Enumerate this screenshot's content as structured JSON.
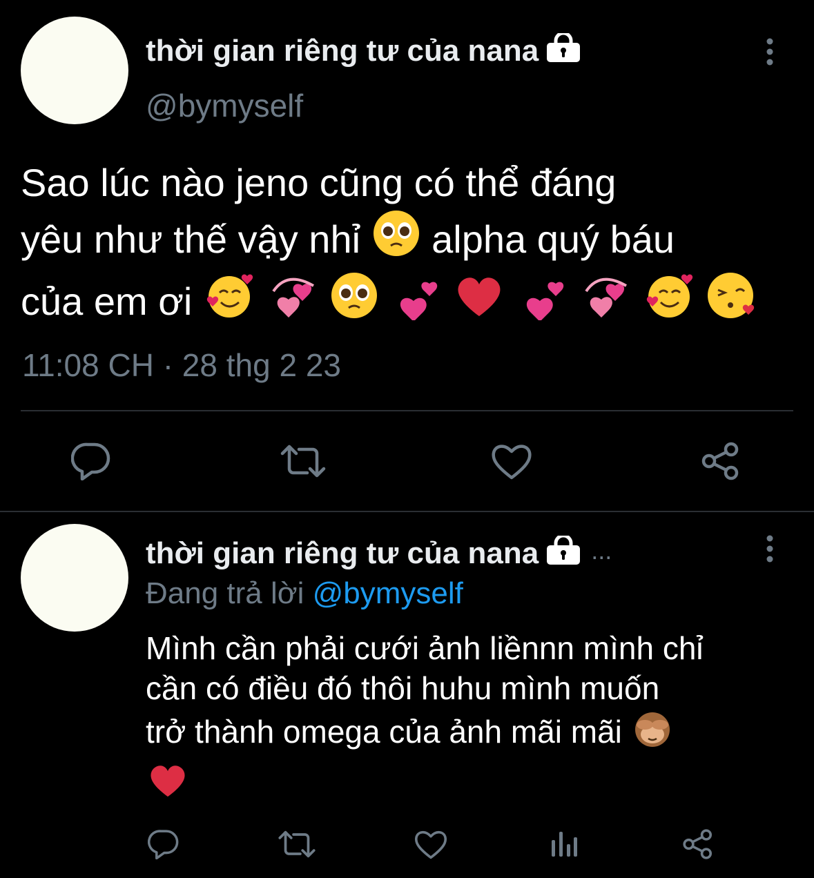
{
  "colors": {
    "background": "#000000",
    "text": "#ffffff",
    "secondary_text": "#6e7b87",
    "mention": "#1d9bf0",
    "divider": "#2a2e33",
    "icon": "#6e7b87",
    "avatar": "#fbfcf2"
  },
  "main_tweet": {
    "display_name": "thời gian riêng tư của nana",
    "handle": "@bymyself",
    "text_line1": "Sao lúc nào jeno cũng có thể đáng",
    "text_line2_a": "yêu như thế vậy nhỉ",
    "text_line2_b": "alpha quý báu",
    "text_line3": "của em ơi",
    "timestamp": "11:08 CH · 28 thg 2 23",
    "icons": {
      "lock": "lock-icon",
      "more": "more-vertical-icon",
      "reply": "comment-icon",
      "retweet": "retweet-icon",
      "like": "heart-outline-icon",
      "share": "share-icon"
    }
  },
  "reply_tweet": {
    "display_name": "thời gian riêng tư của nana",
    "name_overflow": "...",
    "replying_prefix": "Đang trả lời",
    "replying_to": "@bymyself",
    "text_line1": "Mình cần phải cưới ảnh liềnnn mình chỉ",
    "text_line2": "cần có điều đó thôi huhu mình muốn",
    "text_line3": "trở thành omega của ảnh mãi mãi",
    "icons": {
      "reply": "comment-icon",
      "retweet": "retweet-icon",
      "like": "heart-outline-icon",
      "analytics": "analytics-icon",
      "share": "share-icon"
    }
  }
}
